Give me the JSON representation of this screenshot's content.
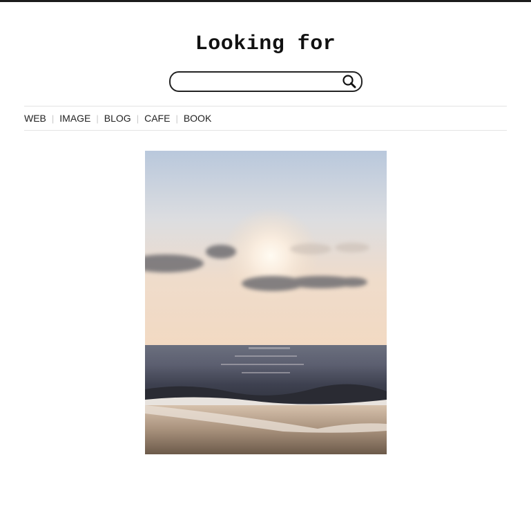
{
  "header": {
    "title": "Looking for"
  },
  "search": {
    "value": "",
    "icon": "search-icon"
  },
  "nav": {
    "items": [
      {
        "label": "WEB"
      },
      {
        "label": "IMAGE"
      },
      {
        "label": "BLOG"
      },
      {
        "label": "CAFE"
      },
      {
        "label": "BOOK"
      }
    ]
  },
  "result": {
    "image": "sunset-beach-photo"
  },
  "colors": {
    "top_border": "#1b1b1b",
    "divider": "#e3e3e3",
    "separator": "#c9c9c9",
    "text": "#222222"
  }
}
